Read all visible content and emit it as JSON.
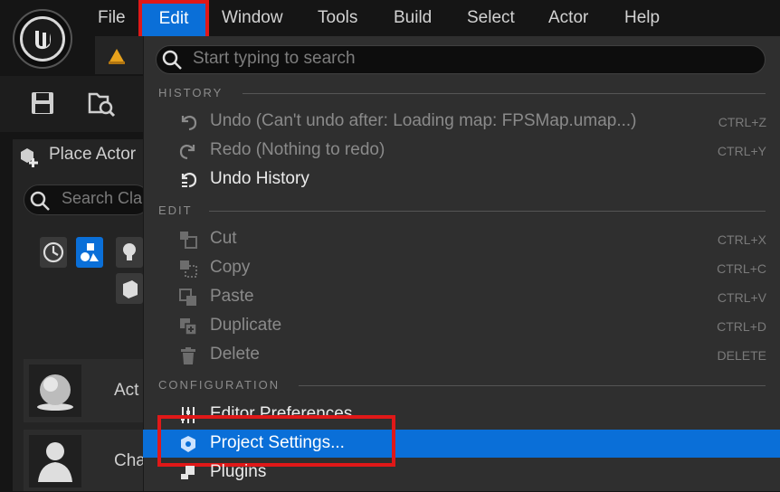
{
  "menubar": {
    "items": [
      "File",
      "Edit",
      "Window",
      "Tools",
      "Build",
      "Select",
      "Actor",
      "Help"
    ]
  },
  "left_panel": {
    "title": "Place Actor",
    "search_placeholder": "Search Cla",
    "actor_rows": [
      "Act",
      "Cha"
    ]
  },
  "dropdown": {
    "search_placeholder": "Start typing to search",
    "sections": {
      "history": "HISTORY",
      "edit": "EDIT",
      "configuration": "CONFIGURATION"
    },
    "items": {
      "undo": {
        "label": "Undo (Can't undo after: Loading map: FPSMap.umap...)",
        "shortcut": "CTRL+Z",
        "icon": "undo-icon"
      },
      "redo": {
        "label": "Redo (Nothing to redo)",
        "shortcut": "CTRL+Y",
        "icon": "redo-icon"
      },
      "undo_history": {
        "label": "Undo History",
        "icon": "undo-history-icon"
      },
      "cut": {
        "label": "Cut",
        "shortcut": "CTRL+X",
        "icon": "cut-icon"
      },
      "copy": {
        "label": "Copy",
        "shortcut": "CTRL+C",
        "icon": "copy-icon"
      },
      "paste": {
        "label": "Paste",
        "shortcut": "CTRL+V",
        "icon": "paste-icon"
      },
      "duplicate": {
        "label": "Duplicate",
        "shortcut": "CTRL+D",
        "icon": "duplicate-icon"
      },
      "delete": {
        "label": "Delete",
        "shortcut": "DELETE",
        "icon": "trash-icon"
      },
      "editor_preferences": {
        "label": "Editor Preferences...",
        "icon": "sliders-icon"
      },
      "project_settings": {
        "label": "Project Settings...",
        "icon": "project-settings-icon"
      },
      "plugins": {
        "label": "Plugins",
        "icon": "plugin-icon"
      }
    }
  },
  "colors": {
    "accent": "#0a6fd8",
    "annotation_red": "#e01818",
    "menu_bg": "#2f2f2f"
  }
}
